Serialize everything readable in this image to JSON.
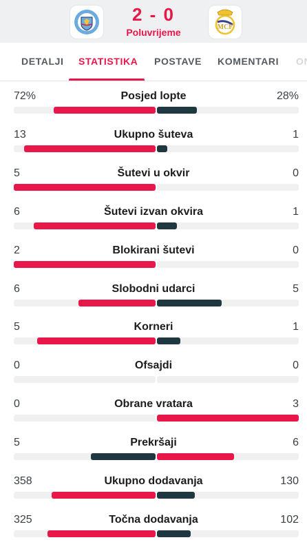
{
  "match": {
    "home_team": "Manchester City",
    "away_team": "Real Madrid",
    "score": "2 - 0",
    "period": "Poluvrijeme"
  },
  "tabs": [
    {
      "label": "DETALJI",
      "active": false
    },
    {
      "label": "STATISTIKA",
      "active": true
    },
    {
      "label": "POSTAVE",
      "active": false
    },
    {
      "label": "KOMENTARI",
      "active": false
    },
    {
      "label": "ON",
      "active": false
    }
  ],
  "colors": {
    "accent": "#e8174a",
    "dark": "#1e3740",
    "track": "#f0f0f0"
  },
  "stats": [
    {
      "label": "Posjed lopte",
      "home": "72%",
      "away": "28%",
      "home_value": 72,
      "away_value": 28,
      "home_color": "accent",
      "away_color": "dark"
    },
    {
      "label": "Ukupno šuteva",
      "home": "13",
      "away": "1",
      "home_value": 13,
      "away_value": 1,
      "home_color": "accent",
      "away_color": "dark"
    },
    {
      "label": "Šutevi u okvir",
      "home": "5",
      "away": "0",
      "home_value": 5,
      "away_value": 0,
      "home_color": "accent",
      "away_color": "dark"
    },
    {
      "label": "Šutevi izvan okvira",
      "home": "6",
      "away": "1",
      "home_value": 6,
      "away_value": 1,
      "home_color": "accent",
      "away_color": "dark"
    },
    {
      "label": "Blokirani šutevi",
      "home": "2",
      "away": "0",
      "home_value": 2,
      "away_value": 0,
      "home_color": "accent",
      "away_color": "dark"
    },
    {
      "label": "Slobodni udarci",
      "home": "6",
      "away": "5",
      "home_value": 6,
      "away_value": 5,
      "home_color": "accent",
      "away_color": "dark"
    },
    {
      "label": "Korneri",
      "home": "5",
      "away": "1",
      "home_value": 5,
      "away_value": 1,
      "home_color": "accent",
      "away_color": "dark"
    },
    {
      "label": "Ofsajdi",
      "home": "0",
      "away": "0",
      "home_value": 0,
      "away_value": 0,
      "home_color": "accent",
      "away_color": "dark"
    },
    {
      "label": "Obrane vratara",
      "home": "0",
      "away": "3",
      "home_value": 0,
      "away_value": 3,
      "home_color": "dark",
      "away_color": "accent"
    },
    {
      "label": "Prekršaji",
      "home": "5",
      "away": "6",
      "home_value": 5,
      "away_value": 6,
      "home_color": "dark",
      "away_color": "accent"
    },
    {
      "label": "Ukupno dodavanja",
      "home": "358",
      "away": "130",
      "home_value": 358,
      "away_value": 130,
      "home_color": "accent",
      "away_color": "dark"
    },
    {
      "label": "Točna dodavanja",
      "home": "325",
      "away": "102",
      "home_value": 325,
      "away_value": 102,
      "home_color": "accent",
      "away_color": "dark"
    }
  ]
}
